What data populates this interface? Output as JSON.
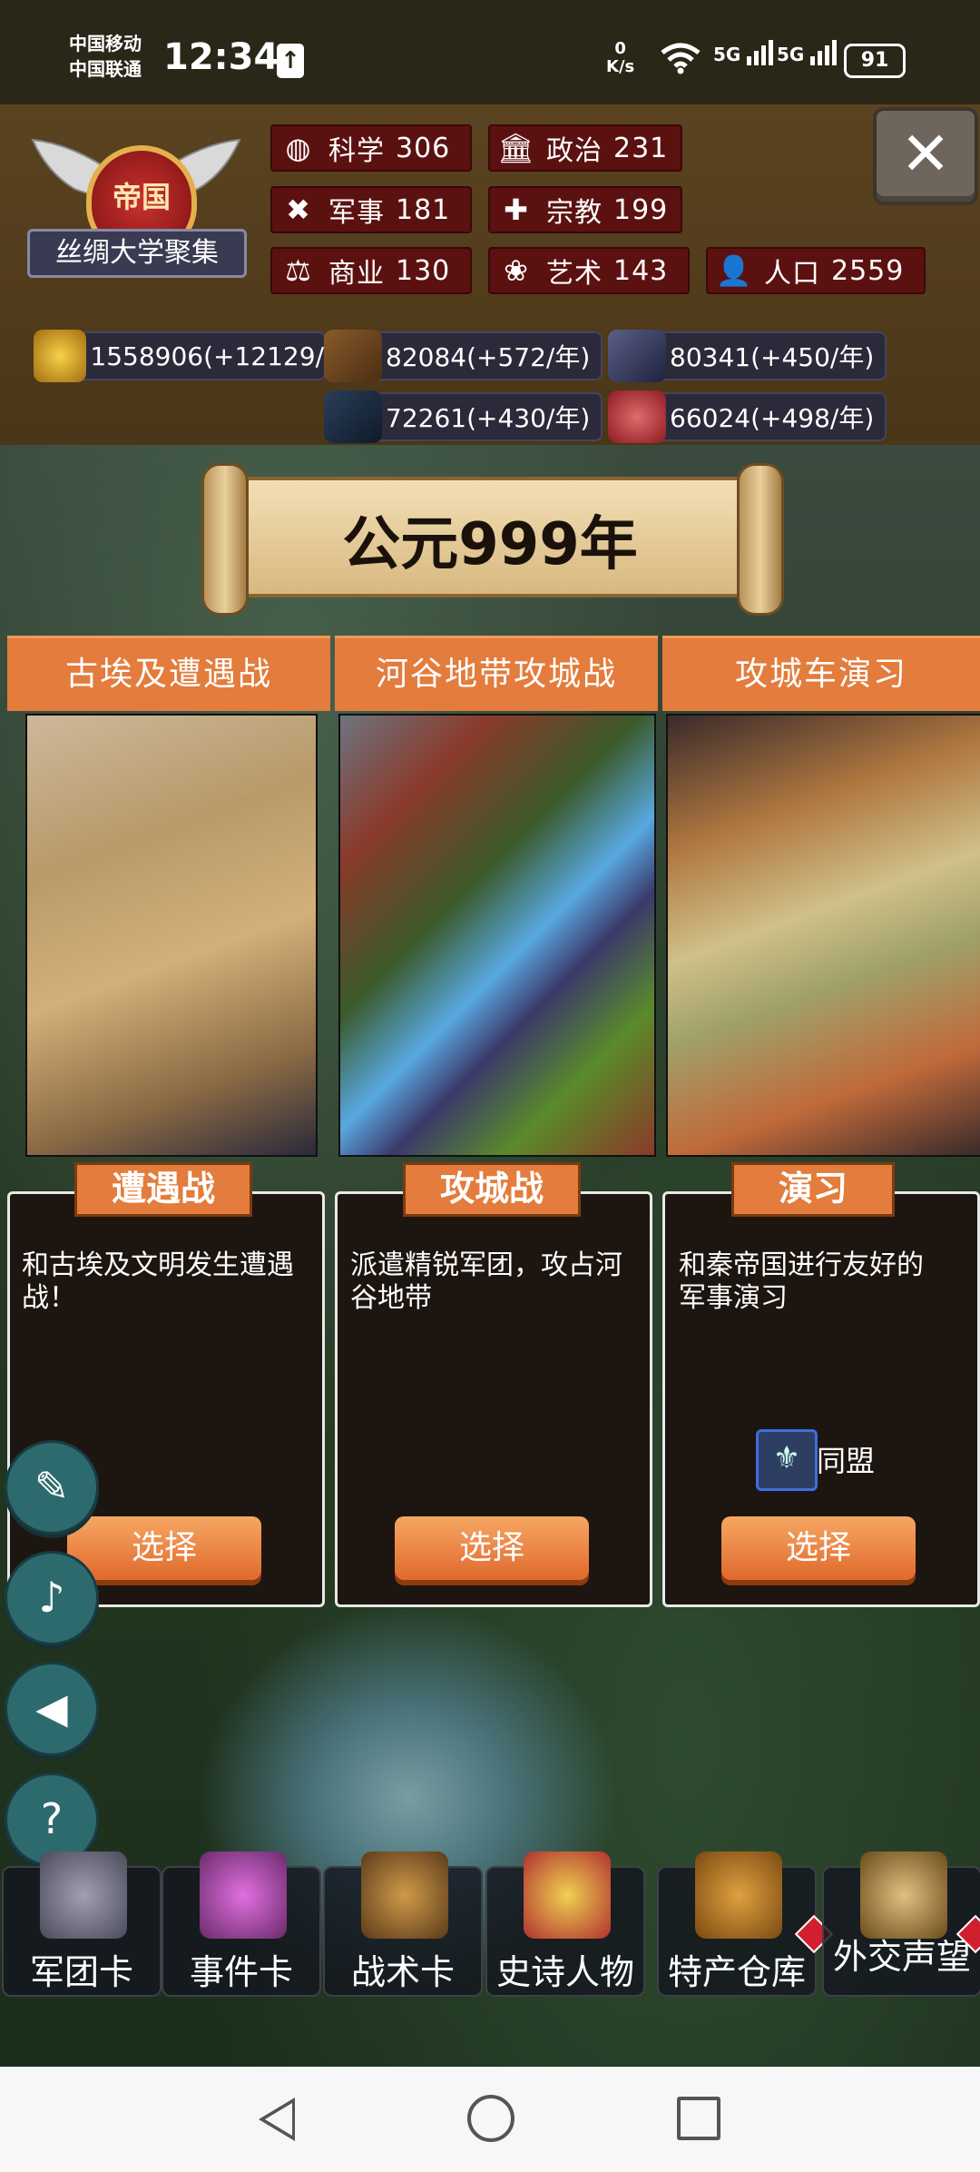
{
  "status_bar": {
    "carrier_1": "中国移动",
    "carrier_2": "中国联通",
    "time": "12:34",
    "net_speed_value": "0",
    "net_speed_unit": "K/s",
    "sim1_type": "5G",
    "sim2_type": "5G",
    "battery": "91"
  },
  "emblem": {
    "title": "帝国",
    "name": "丝绸大学聚集"
  },
  "stats": [
    {
      "icon": "planet-icon",
      "label": "科学",
      "value": "306"
    },
    {
      "icon": "temple-icon",
      "label": "政治",
      "value": "231"
    },
    {
      "icon": "crossed-tools-icon",
      "label": "军事",
      "value": "181"
    },
    {
      "icon": "cross-icon",
      "label": "宗教",
      "value": "199"
    },
    {
      "icon": "scales-icon",
      "label": "商业",
      "value": "130"
    },
    {
      "icon": "lotus-icon",
      "label": "艺术",
      "value": "143"
    },
    {
      "icon": "person-icon",
      "label": "人口",
      "value": "2559"
    }
  ],
  "resources": [
    {
      "icon": "gold-coins-icon",
      "text": "1558906(+12129/"
    },
    {
      "icon": "wood-logs-icon",
      "text": "82084(+572/年)"
    },
    {
      "icon": "stone-ore-icon",
      "text": "80341(+450/年)"
    },
    {
      "icon": "iron-ingot-icon",
      "text": "72261(+430/年)"
    },
    {
      "icon": "meat-icon",
      "text": "66024(+498/年)"
    }
  ],
  "year_banner": "公元999年",
  "cards": [
    {
      "header": "古埃及遭遇战",
      "tag": "遭遇战",
      "description": "和古埃及文明发生遭遇战！",
      "button": "选择"
    },
    {
      "header": "河谷地带攻城战",
      "tag": "攻城战",
      "description": "派遣精锐军团，攻占河谷地带",
      "button": "选择"
    },
    {
      "header": "攻城车演习",
      "tag": "演习",
      "description": "和秦帝国进行友好的军事演习",
      "button": "选择",
      "extra": "同盟"
    }
  ],
  "side_buttons": [
    {
      "name": "history-book-button",
      "glyph": "✎"
    },
    {
      "name": "music-off-button",
      "glyph": "♪"
    },
    {
      "name": "sound-button",
      "glyph": "◀"
    },
    {
      "name": "help-button",
      "glyph": "?"
    }
  ],
  "tabs": [
    {
      "label": "军团卡",
      "icon": "helmet-icon"
    },
    {
      "label": "事件卡",
      "icon": "scroll-icon"
    },
    {
      "label": "战术卡",
      "icon": "shield-swords-icon"
    },
    {
      "label": "史诗人物",
      "icon": "crown-icon"
    },
    {
      "label": "特产仓库",
      "icon": "treasure-chest-icon"
    },
    {
      "label": "外交声望",
      "icon": "envelope-icon"
    }
  ],
  "colors": {
    "accent_orange": "#e37c3c",
    "stat_bg": "#5c1111",
    "side_button": "#2c6a6e"
  }
}
